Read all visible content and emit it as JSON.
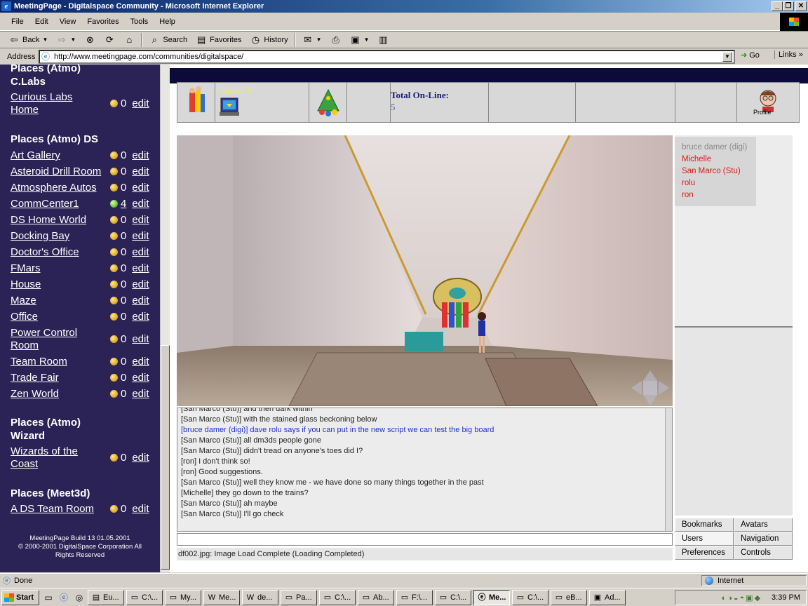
{
  "window": {
    "title": "MeetingPage - Digitalspace Community - Microsoft Internet Explorer",
    "min": "_",
    "max": "❐",
    "close": "✕"
  },
  "menu": [
    "File",
    "Edit",
    "View",
    "Favorites",
    "Tools",
    "Help"
  ],
  "toolbar": {
    "back": "Back",
    "search": "Search",
    "favorites": "Favorites",
    "history": "History"
  },
  "address": {
    "label": "Address",
    "url": "http://www.meetingpage.com/communities/digitalspace/",
    "go": "Go",
    "links": "Links"
  },
  "sidebar": {
    "top_cut": "Places (Atmo)",
    "sections": [
      {
        "title": "C.Labs",
        "places": [
          {
            "name": "Curious Labs",
            "name2": "Home",
            "count": "0",
            "green": false
          }
        ]
      },
      {
        "title": "Places (Atmo) DS",
        "places": [
          {
            "name": "Art Gallery",
            "count": "0",
            "green": false
          },
          {
            "name": "Asteroid Drill Room",
            "count": "0",
            "green": false
          },
          {
            "name": "Atmosphere Autos",
            "count": "0",
            "green": false
          },
          {
            "name": "CommCenter1",
            "count": "4",
            "green": true
          },
          {
            "name": "DS Home World",
            "count": "0",
            "green": false
          },
          {
            "name": "Docking Bay",
            "count": "0",
            "green": false
          },
          {
            "name": "Doctor's Office",
            "count": "0",
            "green": false
          },
          {
            "name": "FMars",
            "count": "0",
            "green": false
          },
          {
            "name": "House",
            "count": "0",
            "green": false
          },
          {
            "name": "Maze",
            "count": "0",
            "green": false
          },
          {
            "name": "Office",
            "count": "0",
            "green": false
          },
          {
            "name": "Power Control",
            "name2": "Room",
            "count": "0",
            "green": false
          },
          {
            "name": "Team Room",
            "count": "0",
            "green": false
          },
          {
            "name": "Trade Fair",
            "count": "0",
            "green": false
          },
          {
            "name": "Zen World",
            "count": "0",
            "green": false
          }
        ]
      },
      {
        "title": "Places (Atmo)",
        "title2": "Wizard",
        "places": [
          {
            "name": "Wizards of the",
            "name2": "Coast",
            "count": "0",
            "green": false
          }
        ]
      },
      {
        "title": "Places (Meet3d)",
        "places": [
          {
            "name": "A DS Team Room",
            "count": "0",
            "green": false
          }
        ]
      }
    ],
    "edit_label": "edit",
    "footer": {
      "line1": "MeetingPage Build 13  01.05.2001",
      "line2": "© 2000-2001 DigitalSpace Corporation All",
      "line3": "Rights Reserved"
    }
  },
  "status_strip": {
    "unread": "Unread: 0",
    "total_online_label": "Total On-Line:",
    "total_online": "5",
    "profile": "Profile"
  },
  "users": [
    {
      "name": "bruce damer (digi)",
      "self": true
    },
    {
      "name": "Michelle",
      "self": false
    },
    {
      "name": "San Marco (Stu)",
      "self": false
    },
    {
      "name": "rolu",
      "self": false
    },
    {
      "name": "ron",
      "self": false
    }
  ],
  "panel_buttons": {
    "bookmarks": "Bookmarks",
    "avatars": "Avatars",
    "users": "Users",
    "navigation": "Navigation",
    "preferences": "Preferences",
    "controls": "Controls"
  },
  "chat": [
    {
      "text": "[San Marco (Stu)] and then dark within",
      "blue": false
    },
    {
      "text": "[San Marco (Stu)] with the stained glass beckoning below",
      "blue": false
    },
    {
      "text": "[bruce damer (digi)] dave rolu says if you can put in the new script we can test the big board",
      "blue": true
    },
    {
      "text": "[San Marco (Stu)] all dm3ds people gone",
      "blue": false
    },
    {
      "text": "[San Marco (Stu)] didn't tread on anyone's toes did I?",
      "blue": false
    },
    {
      "text": "[ron] I don't think so!",
      "blue": false
    },
    {
      "text": "[ron] Good suggestions.",
      "blue": false
    },
    {
      "text": "[San Marco (Stu)] well they know me - we have done so many things together in the past",
      "blue": false
    },
    {
      "text": "[Michelle] they go down to the trains?",
      "blue": false
    },
    {
      "text": "[San Marco (Stu)] ah maybe",
      "blue": false
    },
    {
      "text": "[San Marco (Stu)] I'll go check",
      "blue": false
    }
  ],
  "load_status": "df002.jpg: Image Load Complete (Loading Completed)",
  "statusbar": {
    "done": "Done",
    "zone": "Internet"
  },
  "taskbar": {
    "start": "Start",
    "tasks": [
      {
        "label": "Eu...",
        "active": false
      },
      {
        "label": "C:\\...",
        "active": false
      },
      {
        "label": "My...",
        "active": false
      },
      {
        "label": "Me...",
        "active": false
      },
      {
        "label": "de...",
        "active": false
      },
      {
        "label": "Pa...",
        "active": false
      },
      {
        "label": "C:\\...",
        "active": false
      },
      {
        "label": "Ab...",
        "active": false
      },
      {
        "label": "F:\\...",
        "active": false
      },
      {
        "label": "C:\\...",
        "active": false
      },
      {
        "label": "Me...",
        "active": true
      },
      {
        "label": "C:\\...",
        "active": false
      },
      {
        "label": "eB...",
        "active": false
      },
      {
        "label": "Ad...",
        "active": false
      }
    ],
    "clock": "3:39 PM"
  }
}
